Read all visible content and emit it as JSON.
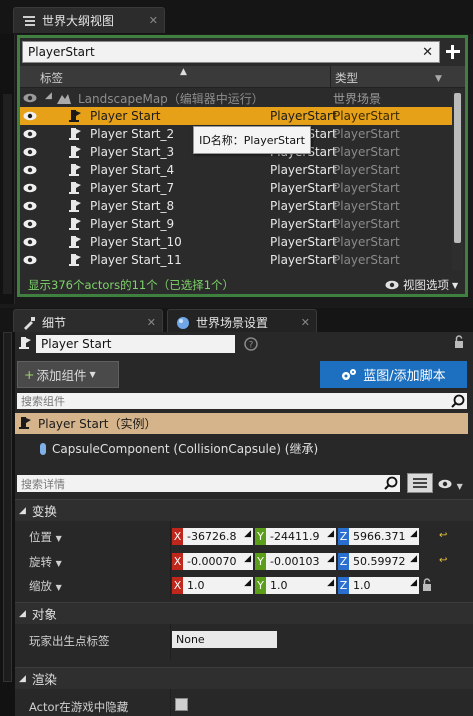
{
  "outliner": {
    "tab_title": "世界大纲视图",
    "search_value": "PlayerStart",
    "col_label": "标签",
    "col_type": "类型",
    "map_row": {
      "label": "LandscapeMap（编辑器中运行）",
      "type": "世界场景"
    },
    "rows": [
      {
        "label": "Player Start",
        "type": "PlayerStart",
        "type2": "PlayerStart"
      },
      {
        "label": "Player Start_2",
        "type": "PlayerStart",
        "type2": "PlayerStart"
      },
      {
        "label": "Player Start_3",
        "type": "PlayerStart",
        "type2": "PlayerStart"
      },
      {
        "label": "Player Start_4",
        "type": "PlayerStart",
        "type2": "PlayerStart"
      },
      {
        "label": "Player Start_7",
        "type": "PlayerStart",
        "type2": "PlayerStart"
      },
      {
        "label": "Player Start_8",
        "type": "PlayerStart",
        "type2": "PlayerStart"
      },
      {
        "label": "Player Start_9",
        "type": "PlayerStart",
        "type2": "PlayerStart"
      },
      {
        "label": "Player Start_10",
        "type": "PlayerStart",
        "type2": "PlayerStart"
      },
      {
        "label": "Player Start_11",
        "type": "PlayerStart",
        "type2": "PlayerStart"
      }
    ],
    "tooltip": "ID名称：PlayerStart",
    "status": "显示376个actors的11个（已选择1个）",
    "view_options": "视图选项"
  },
  "details": {
    "tab_details": "细节",
    "tab_world": "世界场景设置",
    "actor_name": "Player Start",
    "add_component": "添加组件",
    "blueprint_button": "蓝图/添加脚本",
    "search_components_placeholder": "搜索组件",
    "root_component": "Player Start（实例）",
    "child_component": "CapsuleComponent (CollisionCapsule) (继承)",
    "search_details_placeholder": "搜索详情",
    "transform": {
      "section": "变换",
      "location_label": "位置",
      "rotation_label": "旋转",
      "scale_label": "缩放",
      "location": [
        "-36726.8",
        "-24411.9",
        "5966.371"
      ],
      "rotation": [
        "-0.00070",
        "-0.00103",
        "50.59972"
      ],
      "scale": [
        "1.0",
        "1.0",
        "1.0"
      ]
    },
    "object": {
      "section": "对象",
      "player_start_tag_label": "玩家出生点标签",
      "player_start_tag_value": "None"
    },
    "rendering": {
      "section": "渲染",
      "hidden_in_game_label": "Actor在游戏中隐藏"
    }
  },
  "colors": {
    "selection": "#e6a119",
    "outliner_border": "#3f7f3f",
    "blueprint_button": "#1d6fc0",
    "root_component": "#d5b48c",
    "status_text": "#7ed36a"
  }
}
